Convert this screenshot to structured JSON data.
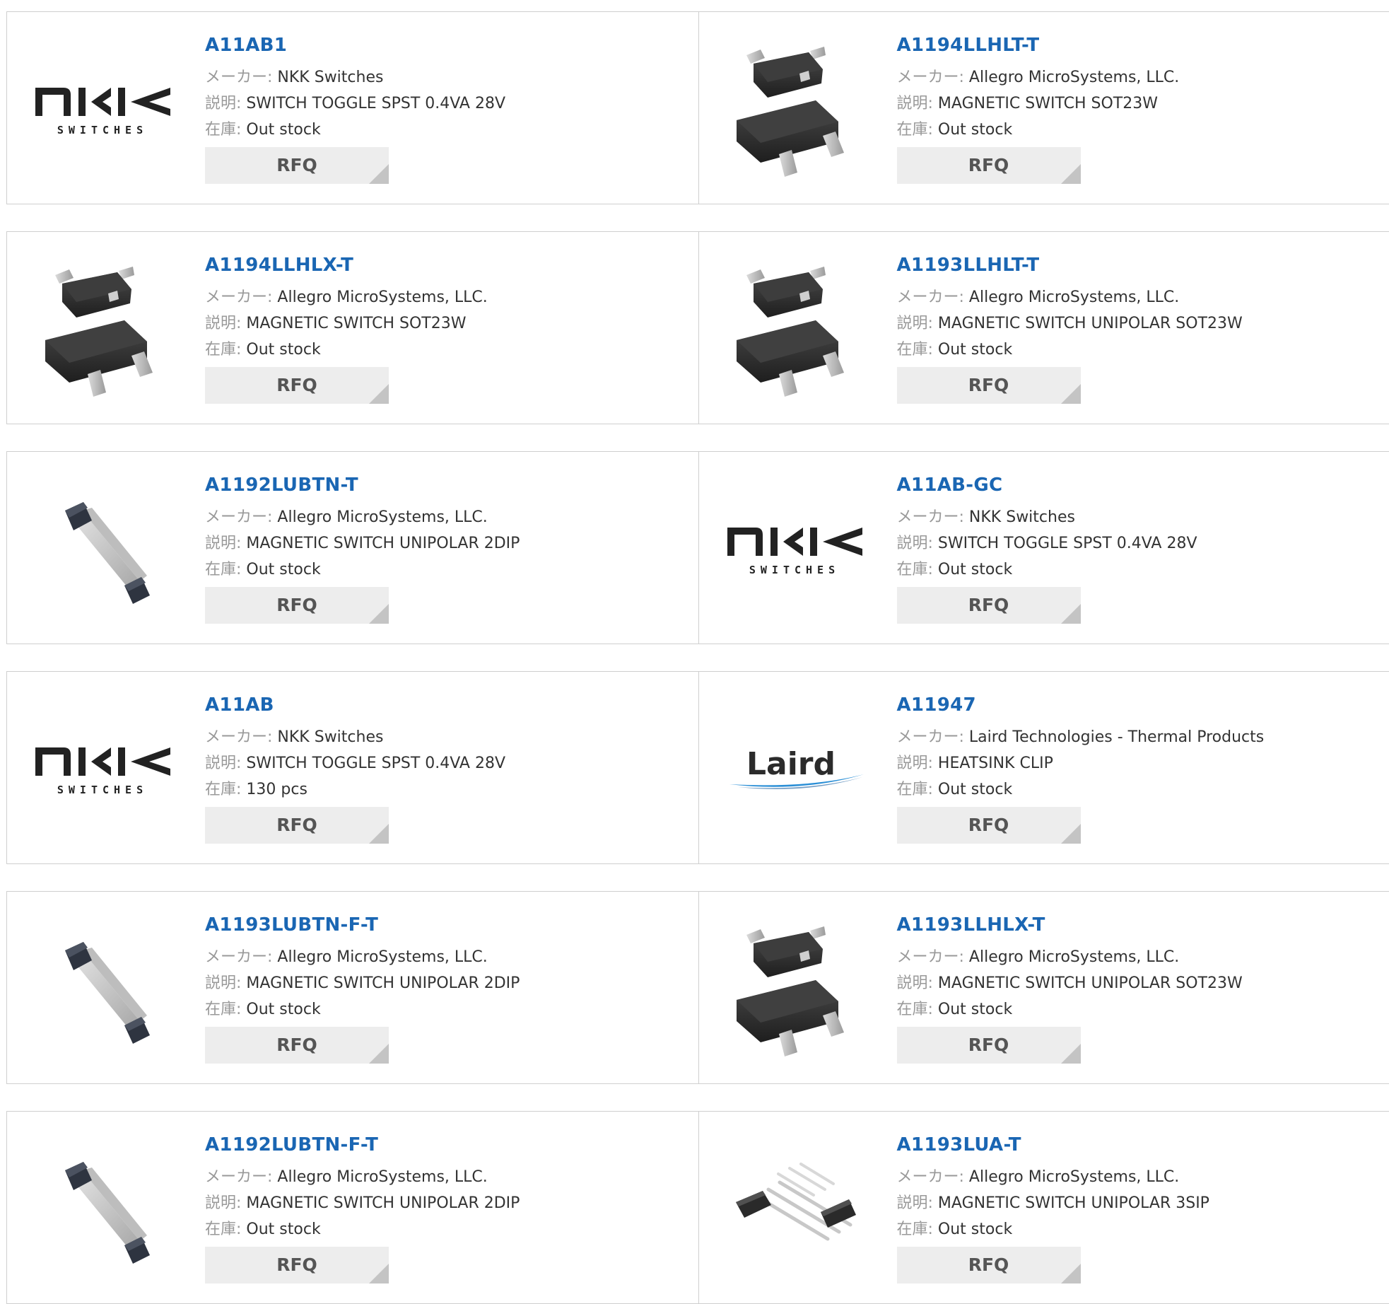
{
  "labels": {
    "maker": "メーカー:",
    "desc": "説明:",
    "stock": "在庫:",
    "rfq": "RFQ"
  },
  "brands": {
    "nkk": {
      "word": "NKK",
      "sub": "SWITCHES"
    },
    "laird": {
      "word": "Laird"
    }
  },
  "colors": {
    "link": "#1a66b3",
    "label_gray": "#999999",
    "border": "#cfcfcf",
    "button_bg": "#ededed",
    "laird_swoosh": "#2b8fd6"
  },
  "products": [
    {
      "part": "A11AB1",
      "maker": "NKK Switches",
      "desc": "SWITCH TOGGLE SPST 0.4VA 28V",
      "stock": "Out stock",
      "image": "nkk-logo"
    },
    {
      "part": "A1194LLHLT-T",
      "maker": "Allegro MicroSystems, LLC.",
      "desc": "MAGNETIC SWITCH SOT23W",
      "stock": "Out stock",
      "image": "sot23-chip"
    },
    {
      "part": "A1194LLHLX-T",
      "maker": "Allegro MicroSystems, LLC.",
      "desc": "MAGNETIC SWITCH SOT23W",
      "stock": "Out stock",
      "image": "sot23-chip"
    },
    {
      "part": "A1193LLHLT-T",
      "maker": "Allegro MicroSystems, LLC.",
      "desc": "MAGNETIC SWITCH UNIPOLAR SOT23W",
      "stock": "Out stock",
      "image": "sot23-chip"
    },
    {
      "part": "A1192LUBTN-T",
      "maker": "Allegro MicroSystems, LLC.",
      "desc": "MAGNETIC SWITCH UNIPOLAR 2DIP",
      "stock": "Out stock",
      "image": "dip2-sensor"
    },
    {
      "part": "A11AB-GC",
      "maker": "NKK Switches",
      "desc": "SWITCH TOGGLE SPST 0.4VA 28V",
      "stock": "Out stock",
      "image": "nkk-logo"
    },
    {
      "part": "A11AB",
      "maker": "NKK Switches",
      "desc": "SWITCH TOGGLE SPST 0.4VA 28V",
      "stock": "130 pcs",
      "image": "nkk-logo"
    },
    {
      "part": "A11947",
      "maker": "Laird Technologies - Thermal Products",
      "desc": "HEATSINK CLIP",
      "stock": "Out stock",
      "image": "laird-logo"
    },
    {
      "part": "A1193LUBTN-F-T",
      "maker": "Allegro MicroSystems, LLC.",
      "desc": "MAGNETIC SWITCH UNIPOLAR 2DIP",
      "stock": "Out stock",
      "image": "dip2-sensor"
    },
    {
      "part": "A1193LLHLX-T",
      "maker": "Allegro MicroSystems, LLC.",
      "desc": "MAGNETIC SWITCH UNIPOLAR SOT23W",
      "stock": "Out stock",
      "image": "sot23-chip"
    },
    {
      "part": "A1192LUBTN-F-T",
      "maker": "Allegro MicroSystems, LLC.",
      "desc": "MAGNETIC SWITCH UNIPOLAR 2DIP",
      "stock": "Out stock",
      "image": "dip2-sensor"
    },
    {
      "part": "A1193LUA-T",
      "maker": "Allegro MicroSystems, LLC.",
      "desc": "MAGNETIC SWITCH UNIPOLAR 3SIP",
      "stock": "Out stock",
      "image": "sip3-sensor"
    }
  ]
}
